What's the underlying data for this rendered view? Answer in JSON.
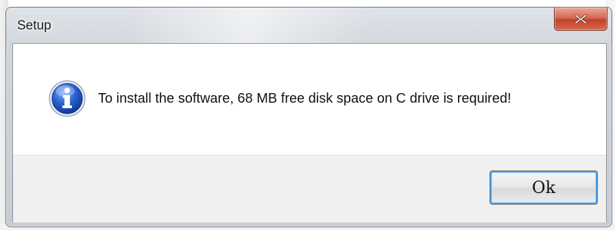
{
  "window": {
    "title": "Setup"
  },
  "dialog": {
    "message": "To install the software, 68 MB free disk space on C drive is required!",
    "icon": "info-icon",
    "ok_label": "Ok"
  },
  "colors": {
    "close_button": "#c1432b",
    "info_icon": "#1f4fbf",
    "ok_focus_ring": "#4aa0e6"
  }
}
